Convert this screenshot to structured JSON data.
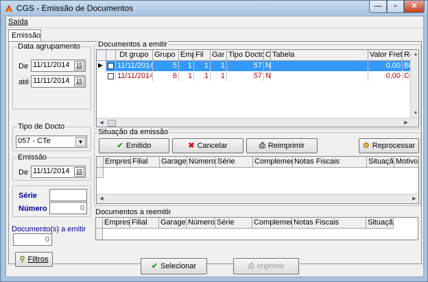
{
  "window": {
    "title": "CGS - Emissão de Documentos",
    "min": "—",
    "max": "▫",
    "close": "✕"
  },
  "menu": {
    "saida": "Saída"
  },
  "tab": {
    "label": "Emissão"
  },
  "data_agrupamento": {
    "label": "Data agrupamento",
    "de_label": "De",
    "de_value": "11/11/2014",
    "ate_label": "até",
    "ate_value": "11/11/2014",
    "cal": "15"
  },
  "tipo_docto": {
    "label": "Tipo de Docto",
    "value": "057 - CTe"
  },
  "emissao_group": {
    "label": "Emissão",
    "de_label": "De",
    "de_value": "11/11/2014"
  },
  "serie": {
    "label": "Série",
    "value": ""
  },
  "numero": {
    "label": "Número",
    "value": "0"
  },
  "documentos_emitir_count": {
    "label": "Documento(s) a emitir",
    "value": "0"
  },
  "filtros_button": "Filtros",
  "docs_emitir": {
    "label": "Documentos a emitir",
    "columns": [
      "Dt grupo",
      "Grupo",
      "Emp",
      "Fil",
      "Gar",
      "Tipo Docto",
      "C",
      "Tabela",
      "Valor Frete",
      "Re"
    ],
    "rows": [
      {
        "dt": "11/11/2014",
        "grupo": "5",
        "emp": "1",
        "fil": "1",
        "gar": "1",
        "tipo": "57",
        "c": "N",
        "tabela": "",
        "valor": "0,00",
        "re": "BH"
      },
      {
        "dt": "11/11/2014",
        "grupo": "6",
        "emp": "1",
        "fil": "1",
        "gar": "1",
        "tipo": "57",
        "c": "N",
        "tabela": "",
        "valor": "0,00",
        "re": "CO"
      }
    ]
  },
  "situacao": {
    "label": "Situação da emissão",
    "emitido": "Emitido",
    "cancelar": "Cancelar",
    "reimprimir": "Reimprimir",
    "reprocessar": "Reprocessar",
    "columns": [
      "Empresa",
      "Filial",
      "Garagem",
      "Número",
      "Série",
      "Complemento",
      "Notas Fiscais",
      "Situação",
      "Motivo do"
    ]
  },
  "reemitir": {
    "label": "Documentos a reemitir",
    "columns": [
      "Empresa",
      "Filial",
      "Garagem",
      "Número",
      "Série",
      "Complemento",
      "Notas Fiscais",
      "Situação"
    ]
  },
  "footer": {
    "selecionar": "Selecionar",
    "imprimir": "Imprimir"
  },
  "colors": {
    "selection": "#3399ff",
    "red_text": "#c00000",
    "blue_label": "#0000a0"
  }
}
